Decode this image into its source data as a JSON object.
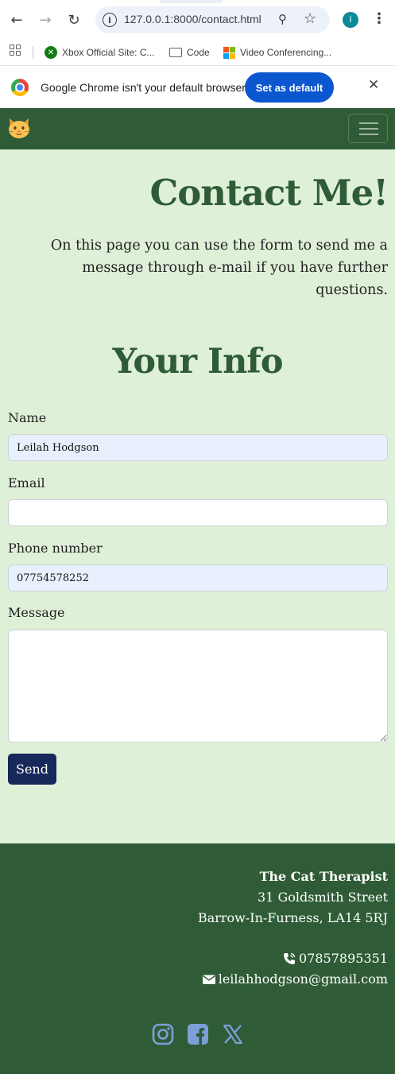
{
  "browser": {
    "url": "127.0.0.1:8000/contact.html",
    "profile_initial": "I",
    "bookmarks": [
      {
        "label": "Xbox Official Site: C...",
        "icon": "xbox-icon"
      },
      {
        "label": "Code",
        "icon": "folder-icon"
      },
      {
        "label": "Video Conferencing...",
        "icon": "microsoft-icon"
      }
    ],
    "infobar": {
      "message": "Google Chrome isn't your default browser",
      "button": "Set as default"
    }
  },
  "site": {
    "brand_icon": "cat-face-icon",
    "colors": {
      "primary": "#2f5c36",
      "background": "#dff0d8",
      "button": "#16295a"
    }
  },
  "page": {
    "title": "Contact Me!",
    "intro": "On this page you can use the form to send me a message through e-mail if you have further questions."
  },
  "form": {
    "heading": "Your Info",
    "name_label": "Name",
    "name_value": "Leilah Hodgson",
    "email_label": "Email",
    "email_value": "",
    "phone_label": "Phone number",
    "phone_value": "07754578252",
    "message_label": "Message",
    "message_value": "",
    "submit_label": "Send"
  },
  "footer": {
    "business_name": "The Cat Therapist",
    "address_line1": "31 Goldsmith Street",
    "address_line2": "Barrow-In-Furness, LA14 5RJ",
    "phone": "07857895351",
    "email": "leilahhodgson@gmail.com",
    "socials": [
      "instagram-icon",
      "facebook-icon",
      "x-twitter-icon"
    ]
  }
}
